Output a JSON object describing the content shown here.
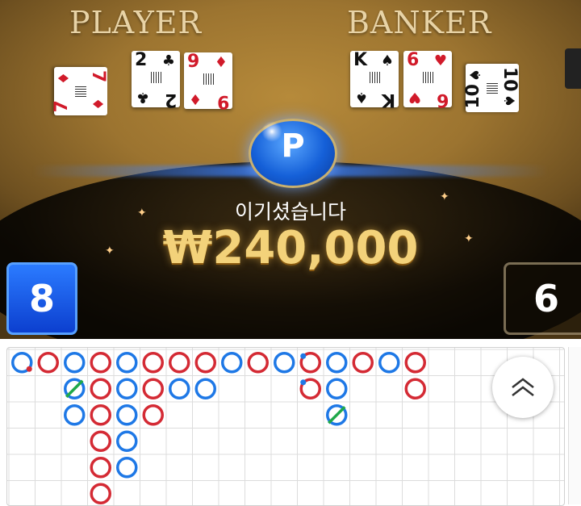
{
  "table": {
    "player_label": "PLAYER",
    "banker_label": "BANKER",
    "player_cards": [
      {
        "rank": "7",
        "suit": "♦",
        "color": "red",
        "rotated": true
      },
      {
        "rank": "2",
        "suit": "♣",
        "color": "black",
        "rotated": false
      },
      {
        "rank": "9",
        "suit": "♦",
        "color": "red",
        "rotated": false
      }
    ],
    "banker_cards": [
      {
        "rank": "K",
        "suit": "♠",
        "color": "black",
        "rotated": false
      },
      {
        "rank": "6",
        "suit": "♥",
        "color": "red",
        "rotated": false
      },
      {
        "rank": "10",
        "suit": "♠",
        "color": "black",
        "rotated": true
      }
    ],
    "winner_badge": "P",
    "win_message": "이기셨습니다",
    "win_amount": "₩240,000",
    "player_score": "8",
    "banker_score": "6"
  },
  "colors": {
    "player_blue": "#1e78e6",
    "banker_red": "#d42a34",
    "tie_green": "#1fa84a",
    "gold": "#f3d27a"
  },
  "bead_road": {
    "columns": [
      [
        "P-bankerpair",
        "B",
        "P",
        "B",
        "P",
        "B",
        "B",
        "B",
        "P",
        "B",
        "P",
        "B-playerpair",
        "P",
        "B",
        "P",
        "B"
      ],
      [
        null,
        null,
        "P-tie",
        "B",
        "P",
        "B",
        "P",
        "P",
        null,
        null,
        null,
        "B-playerpair",
        "P",
        null,
        null,
        "B"
      ],
      [
        null,
        null,
        "P",
        "B",
        "P",
        "B",
        null,
        null,
        null,
        null,
        null,
        null,
        "P-tie",
        null,
        null,
        null
      ],
      [
        null,
        null,
        null,
        "B",
        "P",
        null,
        null,
        null,
        null,
        null,
        null,
        null,
        null,
        null,
        null,
        null
      ],
      [
        null,
        null,
        null,
        "B",
        "P",
        null,
        null,
        null,
        null,
        null,
        null,
        null,
        null,
        null,
        null,
        null
      ],
      [
        null,
        null,
        null,
        "B",
        null,
        null,
        null,
        null,
        null,
        null,
        null,
        null,
        null,
        null,
        null,
        null
      ]
    ]
  },
  "scroll_button": {
    "icon": "double-chevron-up-icon"
  }
}
